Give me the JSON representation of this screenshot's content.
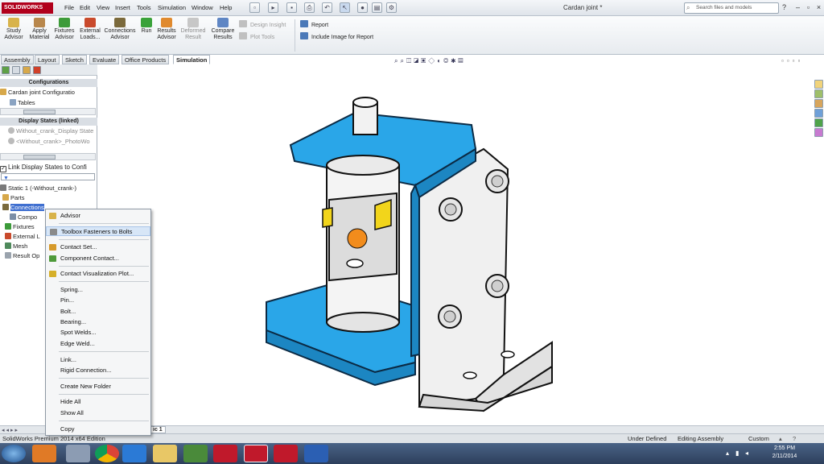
{
  "app": {
    "logo": "SOLIDWORKS",
    "document_title": "Cardan joint *",
    "search_placeholder": "Search files and models",
    "menus": [
      "File",
      "Edit",
      "View",
      "Insert",
      "Tools",
      "Simulation",
      "Window",
      "Help"
    ]
  },
  "ribbon": {
    "buttons": [
      {
        "label1": "Study",
        "label2": "Advisor"
      },
      {
        "label1": "Apply",
        "label2": "Material"
      },
      {
        "label1": "Fixtures",
        "label2": "Advisor"
      },
      {
        "label1": "External",
        "label2": "Loads..."
      },
      {
        "label1": "Connections",
        "label2": "Advisor"
      },
      {
        "label1": "Run",
        "label2": ""
      },
      {
        "label1": "Results",
        "label2": "Advisor"
      },
      {
        "label1": "Deformed",
        "label2": "Result"
      },
      {
        "label1": "Compare",
        "label2": "Results"
      }
    ],
    "design_insight": "Design Insight",
    "plot_tools": "Plot Tools",
    "report": "Report",
    "include_image": "Include Image for Report"
  },
  "tabs": [
    "Assembly",
    "Layout",
    "Sketch",
    "Evaluate",
    "Office Products",
    "Simulation"
  ],
  "left_panel": {
    "configurations_header": "Configurations",
    "config_item": "Cardan joint Configuratio",
    "tables_item": "Tables",
    "display_states_header": "Display States (linked)",
    "display_state_1": "Without_crank_Display State",
    "display_state_2": "<Without_crank>_PhotoWo",
    "link_label": "Link Display States to Confi",
    "tree": {
      "study": "Static 1 (-Without_crank-)",
      "parts": "Parts",
      "connections": "Connections",
      "component": "Compo",
      "fixtures": "Fixtures",
      "external": "External L",
      "mesh": "Mesh",
      "result": "Result Op"
    }
  },
  "context_menu": [
    "Advisor",
    "Toolbox Fasteners to Bolts",
    "Contact Set...",
    "Component Contact...",
    "Contact Visualization Plot...",
    "Spring...",
    "Pin...",
    "Bolt...",
    "Bearing...",
    "Spot Welds...",
    "Edge Weld...",
    "Link...",
    "Rigid Connection...",
    "Create New Folder",
    "Hide All",
    "Show All",
    "Copy"
  ],
  "bottom_tab": "ic 1",
  "status": {
    "edition": "SolidWorks Premium 2014 x64 Edition",
    "under_defined": "Under Defined",
    "editing": "Editing Assembly",
    "custom": "Custom"
  },
  "clock": {
    "time": "2:55 PM",
    "date": "2/11/2014"
  },
  "colors": {
    "accent_blue": "#2aa6e8",
    "model_grey": "#e8e8e8",
    "selection": "#3f6fd0"
  }
}
